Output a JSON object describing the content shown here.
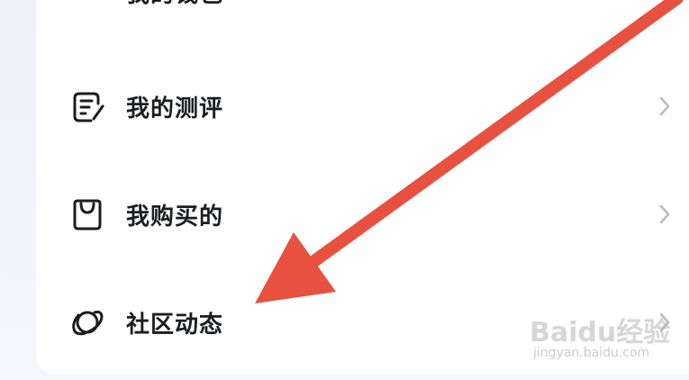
{
  "menu": {
    "items": [
      {
        "label": "我的钱包",
        "icon": "wallet-icon"
      },
      {
        "label": "我的测评",
        "icon": "review-icon"
      },
      {
        "label": "我购买的",
        "icon": "shopping-bag-icon"
      },
      {
        "label": "社区动态",
        "icon": "planet-icon"
      }
    ]
  },
  "watermark": {
    "brand": "Baidu经验",
    "url": "jingyan.baidu.com"
  },
  "colors": {
    "arrow": "#e8503f",
    "text": "#1c1d21",
    "chevron": "#b9bcc4",
    "card": "#ffffff",
    "background": "#f3f5fa"
  }
}
